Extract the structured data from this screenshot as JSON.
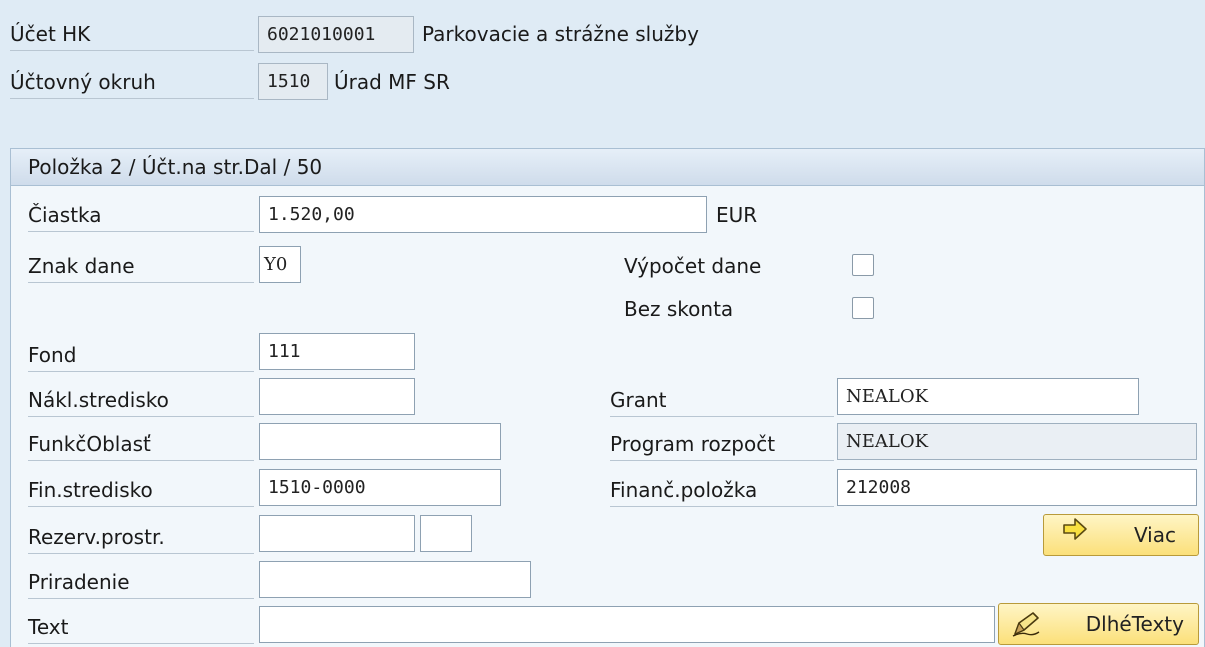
{
  "header": {
    "gl_account": {
      "label": "Účet HK",
      "value": "6021010001",
      "description": "Parkovacie a strážne služby"
    },
    "company_code": {
      "label": "Účtovný okruh",
      "value": "1510",
      "description": "Úrad MF SR"
    }
  },
  "group": {
    "title": "Položka 2 / Účt.na str.Dal / 50",
    "amount": {
      "label": "Čiastka",
      "value": "1.520,00",
      "currency": "EUR"
    },
    "tax_code": {
      "label": "Znak dane",
      "value": "Y0"
    },
    "calc_tax": {
      "label": "Výpočet dane",
      "checked": false
    },
    "no_discount": {
      "label": "Bez skonta",
      "checked": false
    },
    "fund": {
      "label": "Fond",
      "value": "111"
    },
    "cost_center": {
      "label": "Nákl.stredisko",
      "value": ""
    },
    "grant": {
      "label": "Grant",
      "value": "NEALOK"
    },
    "functional_area": {
      "label": "FunkčOblasť",
      "value": ""
    },
    "budget_program": {
      "label": "Program rozpočt",
      "value": "NEALOK"
    },
    "funds_center": {
      "label": "Fin.stredisko",
      "value": "1510-0000"
    },
    "commitment_item": {
      "label": "Finanč.položka",
      "value": "212008"
    },
    "earmarked_funds": {
      "label": "Rezerv.prostr.",
      "value": "",
      "value2": ""
    },
    "more_button": {
      "label": "Viac",
      "icon": "arrow-right-icon"
    },
    "assignment": {
      "label": "Priradenie",
      "value": ""
    },
    "text": {
      "label": "Text",
      "value": ""
    },
    "long_texts_button": {
      "label": "DlhéTexty",
      "icon": "pencil-icon"
    }
  }
}
